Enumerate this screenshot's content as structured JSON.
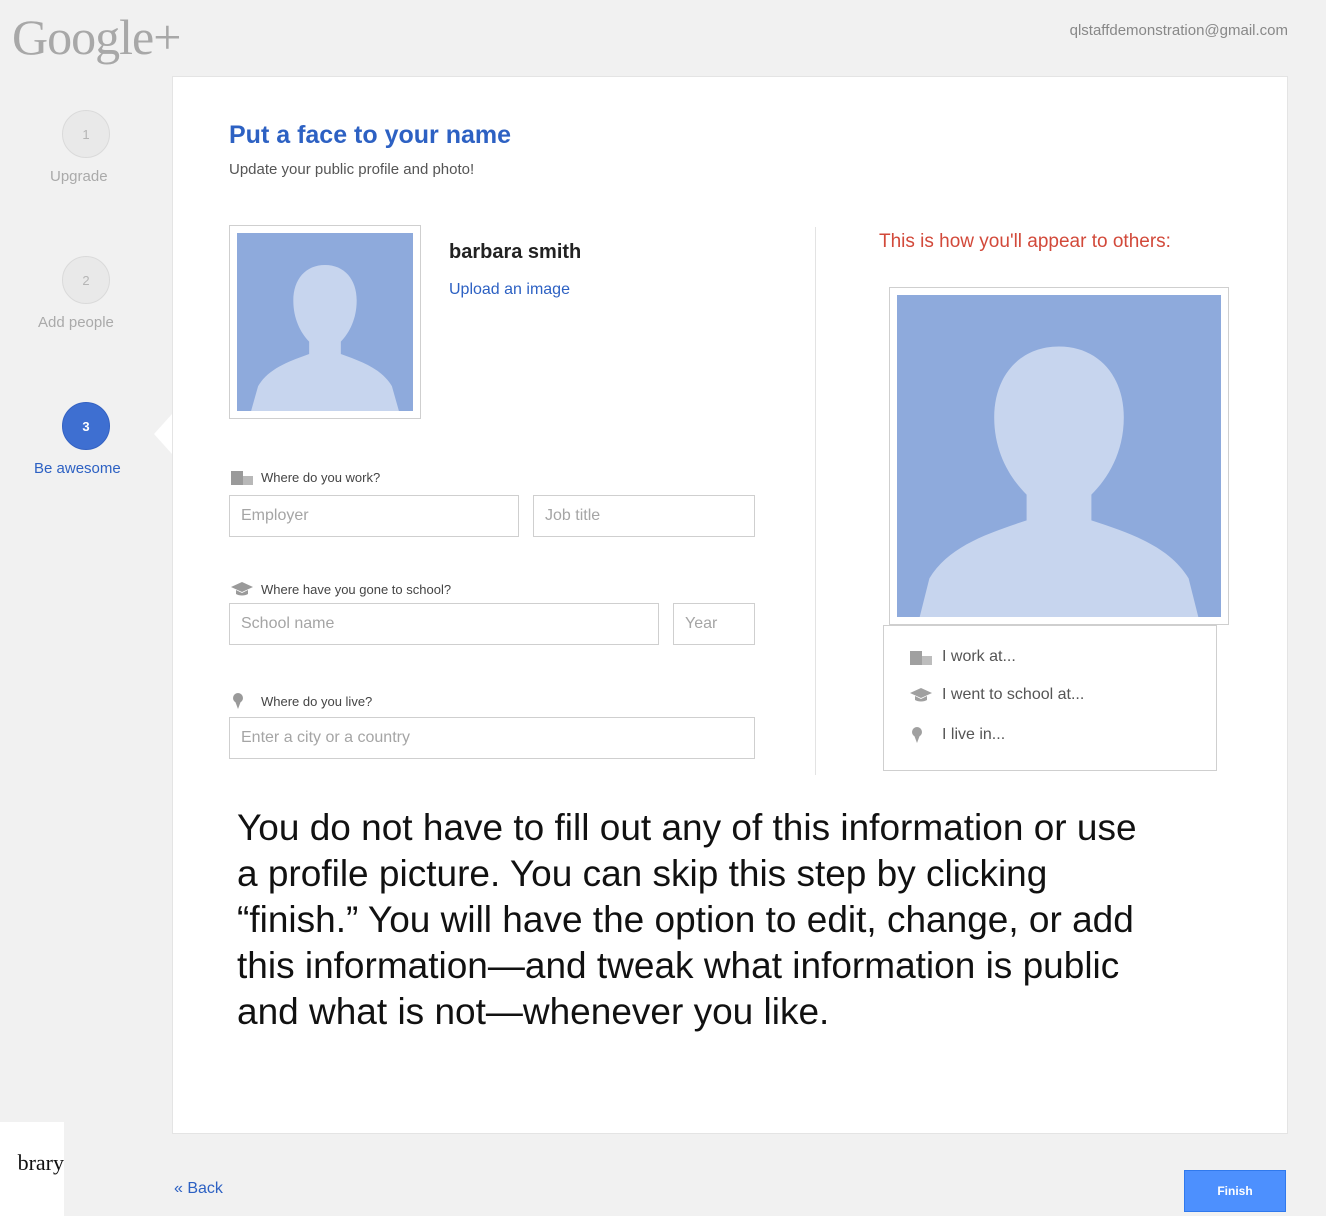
{
  "header": {
    "logo": "Google+",
    "account_email": "qlstaffdemonstration@gmail.com"
  },
  "steps": [
    {
      "number": "1",
      "label": "Upgrade",
      "state": "done"
    },
    {
      "number": "2",
      "label": "Add people",
      "state": "done"
    },
    {
      "number": "3",
      "label": "Be awesome",
      "state": "active"
    }
  ],
  "profile": {
    "heading": "Put a face to your name",
    "subheading": "Update your public profile and photo!",
    "name": "barbara smith",
    "upload_label": "Upload an image"
  },
  "form": {
    "work": {
      "label": "Where do you work?",
      "employer_placeholder": "Employer",
      "job_title_placeholder": "Job title",
      "icon": "building-icon"
    },
    "school": {
      "label": "Where have you gone to school?",
      "school_placeholder": "School name",
      "year_placeholder": "Year",
      "icon": "graduation-cap-icon"
    },
    "live": {
      "label": "Where do you live?",
      "city_placeholder": "Enter a city or a country",
      "icon": "map-pin-icon"
    }
  },
  "preview": {
    "caption": "This is how you'll appear to others:",
    "work_text": "I work at...",
    "school_text": "I went to school at...",
    "live_text": "I live in..."
  },
  "note": "You do not have to fill out any of this information or use a profile picture. You can skip this step by clicking “finish.” You will have the option to edit, change, or add this information—and tweak what information is public and what is not—whenever you like.",
  "footer": {
    "back_label": "« Back",
    "finish_label": "Finish",
    "library_text": "brary"
  },
  "colors": {
    "accent_blue": "#2d61c3",
    "button_blue": "#4d90fe",
    "caption_red": "#d2493a",
    "avatar_bg": "#8eaadc",
    "avatar_silhouette": "#c7d5ee"
  }
}
